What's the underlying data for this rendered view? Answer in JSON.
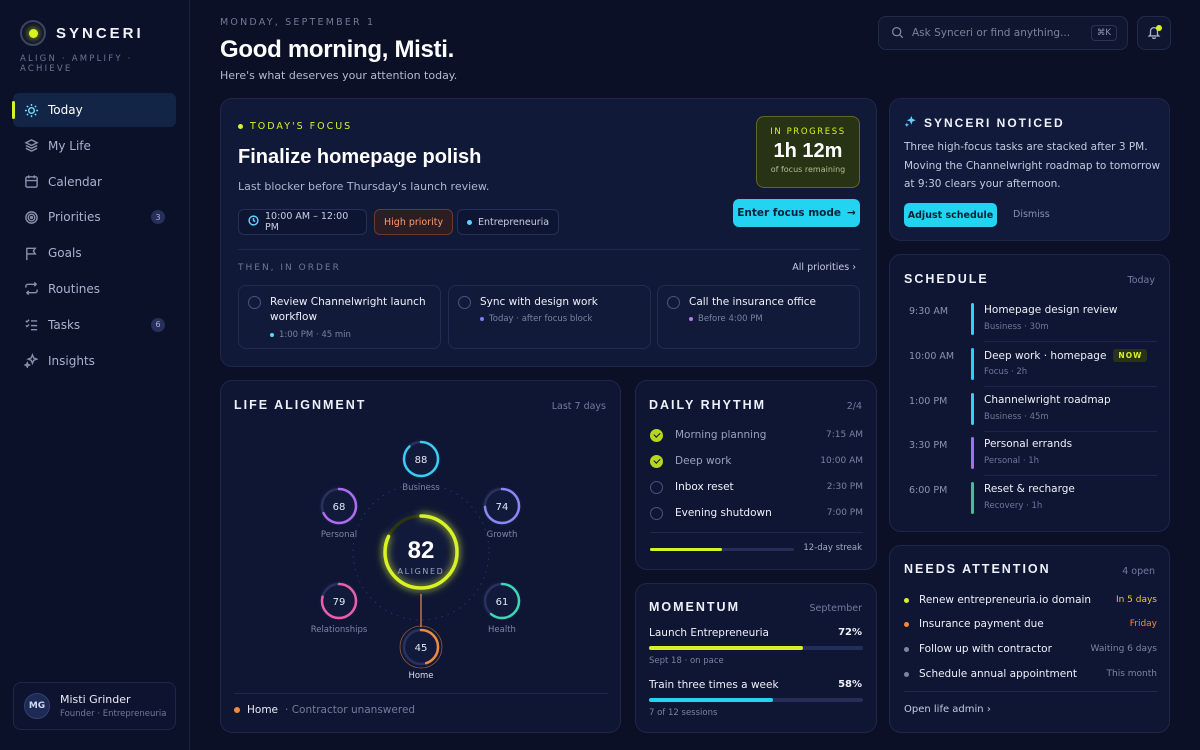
{
  "brand": {
    "name": "SYNCERI",
    "tagline": "ALIGN · AMPLIFY · ACHIEVE",
    "accent": "#d8f227"
  },
  "nav": {
    "items": [
      {
        "label": "Today",
        "icon": "sun-icon",
        "active": true
      },
      {
        "label": "My Life",
        "icon": "layers-icon"
      },
      {
        "label": "Calendar",
        "icon": "calendar-icon"
      },
      {
        "label": "Priorities",
        "icon": "target-icon",
        "badge": "3"
      },
      {
        "label": "Goals",
        "icon": "flag-icon"
      },
      {
        "label": "Routines",
        "icon": "repeat-icon"
      },
      {
        "label": "Tasks",
        "icon": "checklist-icon",
        "badge": "6"
      },
      {
        "label": "Insights",
        "icon": "sparkle-icon"
      }
    ]
  },
  "user": {
    "initials": "MG",
    "name": "Misti Grinder",
    "role": "Founder · Entrepreneuria"
  },
  "header": {
    "date": "MONDAY, SEPTEMBER 1",
    "greeting": "Good morning, Misti.",
    "subtitle": "Here's what deserves your attention today.",
    "search_placeholder": "Ask Synceri or find anything...",
    "search_shortcut": "⌘K"
  },
  "focus": {
    "kicker": "TODAY'S FOCUS",
    "title": "Finalize homepage polish",
    "subtitle": "Last blocker before Thursday's launch review.",
    "time_chip": "10:00 AM – 12:00 PM",
    "priority_chip": "High priority",
    "project_chip": "Entrepreneuria",
    "status_label": "IN PROGRESS",
    "remaining_time": "1h 12m",
    "remaining_label": "of focus remaining",
    "cta": "Enter focus mode",
    "then_label": "THEN, IN ORDER",
    "all_priorities": "All priorities",
    "next_tasks": [
      {
        "title": "Review Channelwright launch workflow",
        "meta": "1:00 PM · 45 min",
        "dot": "#5ad3ff"
      },
      {
        "title": "Sync with design work",
        "meta": "Today · after focus block",
        "dot": "#7a7ff0"
      },
      {
        "title": "Call the insurance office",
        "meta": "Before 4:00 PM",
        "dot": "#b07cf0"
      }
    ]
  },
  "life_alignment": {
    "title": "LIFE ALIGNMENT",
    "period": "Last 7 days",
    "score": "82",
    "score_label": "ALIGNED",
    "score_value": 82,
    "areas": [
      {
        "name": "Business",
        "value": 88,
        "color": "#38cdf5"
      },
      {
        "name": "Growth",
        "value": 74,
        "color": "#8a86f5"
      },
      {
        "name": "Health",
        "value": 61,
        "color": "#3fd6b4"
      },
      {
        "name": "Home",
        "value": 45,
        "color": "#f08a3c"
      },
      {
        "name": "Relationships",
        "value": 79,
        "color": "#ee5ea8"
      },
      {
        "name": "Personal",
        "value": 68,
        "color": "#b06cf0"
      }
    ],
    "footer_area": "Home",
    "footer_note": "· Contractor unanswered"
  },
  "daily_rhythm": {
    "title": "DAILY RHYTHM",
    "count": "2/4",
    "items": [
      {
        "name": "Morning planning",
        "time": "7:15 AM",
        "done": true
      },
      {
        "name": "Deep work",
        "time": "10:00 AM",
        "done": true
      },
      {
        "name": "Inbox reset",
        "time": "2:30 PM",
        "done": false
      },
      {
        "name": "Evening shutdown",
        "time": "7:00 PM",
        "done": false
      }
    ],
    "streak": "12-day streak",
    "streak_progress": 0.5
  },
  "momentum": {
    "title": "MOMENTUM",
    "period": "September",
    "goals": [
      {
        "name": "Launch Entrepreneuria",
        "percent": "72%",
        "progress": 0.72,
        "sub": "Sept 18 · on pace",
        "color": "#d8f227"
      },
      {
        "name": "Train three times a week",
        "percent": "58%",
        "progress": 0.58,
        "sub": "7 of 12 sessions",
        "color": "#22d3f2"
      }
    ]
  },
  "noticed": {
    "title": "SYNCERI NOTICED",
    "body": "Three high-focus tasks are stacked after 3 PM. Moving the Channelwright roadmap to tomorrow at 9:30 clears your afternoon.",
    "primary": "Adjust schedule",
    "secondary": "Dismiss"
  },
  "schedule": {
    "title": "SCHEDULE",
    "period": "Today",
    "now_badge": "NOW",
    "events": [
      {
        "time": "9:30 AM",
        "title": "Homepage design review",
        "sub": "Business · 30m",
        "color": "#38cdf5"
      },
      {
        "time": "10:00 AM",
        "title": "Deep work · homepage",
        "sub": "Focus · 2h",
        "color": "#22d3f2",
        "now": true
      },
      {
        "time": "1:00 PM",
        "title": "Channelwright roadmap",
        "sub": "Business · 45m",
        "color": "#38cdf5"
      },
      {
        "time": "3:30 PM",
        "title": "Personal errands",
        "sub": "Personal · 1h",
        "color": "#a070f0"
      },
      {
        "time": "6:00 PM",
        "title": "Reset & recharge",
        "sub": "Recovery · 1h",
        "color": "#3fbf9a"
      }
    ]
  },
  "attention": {
    "title": "NEEDS ATTENTION",
    "count": "4 open",
    "items": [
      {
        "name": "Renew entrepreneuria.io domain",
        "when": "In 5 days",
        "dot": "#d8f227",
        "when_color": "#e7c93a"
      },
      {
        "name": "Insurance payment due",
        "when": "Friday",
        "dot": "#f08a3c",
        "when_color": "#f08a3c"
      },
      {
        "name": "Follow up with contractor",
        "when": "Waiting 6 days",
        "dot": "#7d85a3",
        "when_color": "#7d85a3"
      },
      {
        "name": "Schedule annual appointment",
        "when": "This month",
        "dot": "#7d85a3",
        "when_color": "#7d85a3"
      }
    ],
    "link": "Open life admin"
  }
}
